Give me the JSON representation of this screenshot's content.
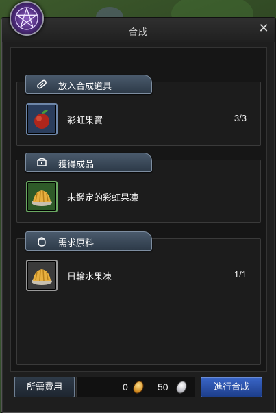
{
  "window": {
    "title": "合成",
    "close_symbol": "✕"
  },
  "sections": {
    "input": {
      "label": "放入合成道具",
      "icon": "bandage-icon",
      "item": {
        "name": "彩虹果實",
        "count": "3/3",
        "icon": "rainbow-fruit-icon"
      }
    },
    "output": {
      "label": "獲得成品",
      "icon": "chest-icon",
      "item": {
        "name": "未鑑定的彩虹果凍",
        "icon": "jelly-icon"
      }
    },
    "materials": {
      "label": "需求原料",
      "icon": "pouch-icon",
      "item": {
        "name": "日輪水果凍",
        "count": "1/1",
        "icon": "jelly-icon"
      }
    }
  },
  "footer": {
    "fee_label": "所需費用",
    "gold_amount": "0",
    "silver_amount": "50",
    "confirm_label": "進行合成"
  },
  "colors": {
    "accent_button": "#2a52a8",
    "header_blue": "#3a4a5c"
  }
}
